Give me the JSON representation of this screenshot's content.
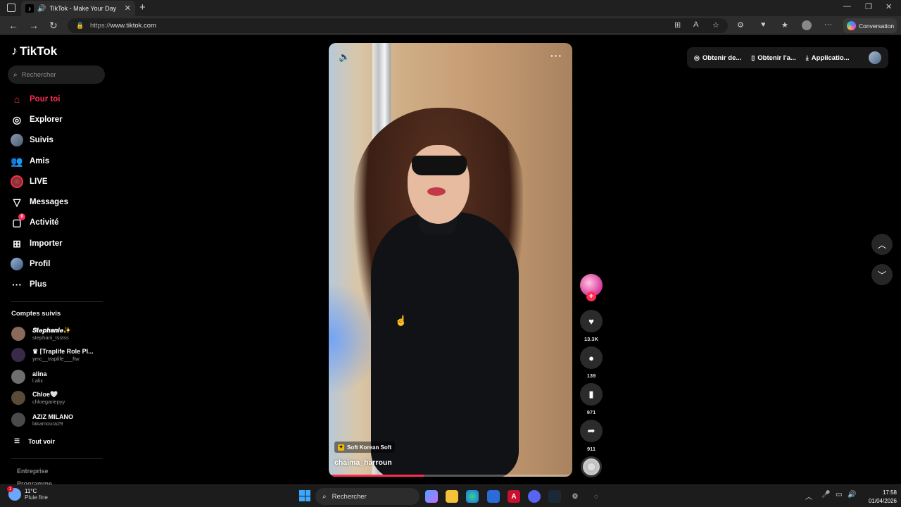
{
  "browser": {
    "tab_title": "TikTok - Make Your Day",
    "url_proto": "https://",
    "url_host": "www.tiktok.com",
    "conversation_label": "Conversation"
  },
  "sidebar": {
    "logo": "TikTok",
    "search_placeholder": "Rechercher",
    "nav": [
      {
        "label": "Pour toi",
        "icon": "home-icon",
        "active": true
      },
      {
        "label": "Explorer",
        "icon": "compass-icon"
      },
      {
        "label": "Suivis",
        "icon": "following-avatar-icon"
      },
      {
        "label": "Amis",
        "icon": "friends-icon"
      },
      {
        "label": "LIVE",
        "icon": "live-icon"
      },
      {
        "label": "Messages",
        "icon": "messages-icon"
      },
      {
        "label": "Activité",
        "icon": "activity-icon",
        "badge": "9"
      },
      {
        "label": "Importer",
        "icon": "upload-icon"
      },
      {
        "label": "Profil",
        "icon": "profile-avatar-icon"
      },
      {
        "label": "Plus",
        "icon": "more-icon"
      }
    ],
    "following_title": "Comptes suivis",
    "accounts": [
      {
        "name": "𝑺𝒕𝒆𝒑𝒉𝒂𝒏𝒊𝒆✨",
        "username": "stephani_tsstss",
        "color": "#8c6a5a"
      },
      {
        "name": "♛ ⌈Traplife Role Pl...",
        "username": "ymc__traplife___ftw",
        "color": "#3a2a4a"
      },
      {
        "name": "alina",
        "username": "l.alix",
        "color": "#6e6e6e"
      },
      {
        "name": "Chloe🤍",
        "username": "chloegariepyy",
        "color": "#5a4a3a"
      },
      {
        "name": "AZIZ MILANO",
        "username": "lakamoura29",
        "color": "#4a4a4a"
      }
    ],
    "see_all": "Tout voir",
    "footer": [
      "Entreprise",
      "Programme"
    ]
  },
  "video": {
    "tag": "Soft Korean Soft",
    "author": "chaima_harroun",
    "progress": 0.39
  },
  "actions": {
    "likes": "13.3K",
    "comments": "139",
    "saves": "971",
    "shares": "911"
  },
  "topbar": {
    "item1": "Obtenir de...",
    "item2": "Obtenir l'a...",
    "item3": "Applicatio..."
  },
  "taskbar": {
    "temp": "11°C",
    "weather": "Pluie fine",
    "weather_badge": "1",
    "search": "Rechercher",
    "time": "17:58",
    "date": "01/04/2026"
  },
  "colors": {
    "accent": "#fe2c55",
    "background": "#000000"
  }
}
